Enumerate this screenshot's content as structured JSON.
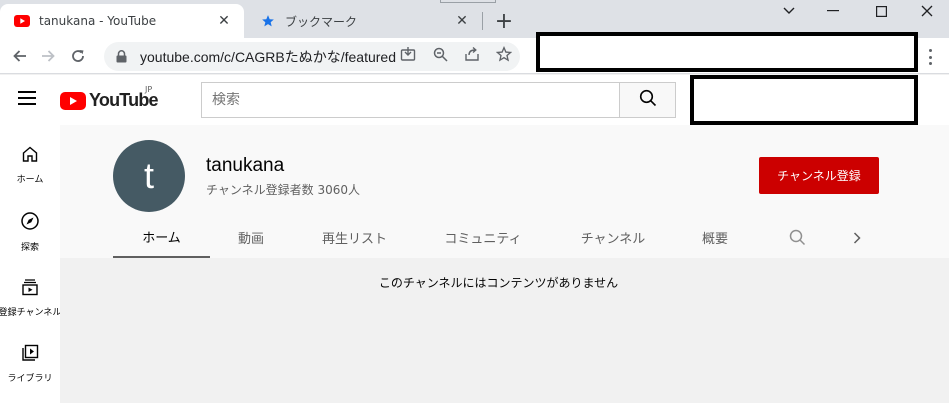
{
  "browser": {
    "tabs": [
      {
        "title": "tanukana - YouTube",
        "active": true,
        "favicon": "youtube-icon"
      },
      {
        "title": "ブックマーク",
        "active": false,
        "favicon": "star-icon"
      }
    ],
    "url": "youtube.com/c/CAGRBたぬかな/featured"
  },
  "youtube": {
    "search_placeholder": "検索",
    "logo_text": "YouTube",
    "region": "JP"
  },
  "guide": {
    "items": [
      {
        "label": "ホーム",
        "icon": "home-icon"
      },
      {
        "label": "探索",
        "icon": "compass-icon"
      },
      {
        "label": "登録チャンネル",
        "icon": "subscriptions-icon"
      },
      {
        "label": "ライブラリ",
        "icon": "library-icon"
      }
    ]
  },
  "channel": {
    "avatar_letter": "t",
    "name": "tanukana",
    "subscribers": "チャンネル登録者数 3060人",
    "subscribe_label": "チャンネル登録",
    "tabs": [
      "ホーム",
      "動画",
      "再生リスト",
      "コミュニティ",
      "チャンネル",
      "概要"
    ],
    "selected_tab": "ホーム"
  },
  "content": {
    "empty_message": "このチャンネルにはコンテンツがありません"
  },
  "colors": {
    "brand_red": "#ff0000",
    "subscribe_red": "#cc0000",
    "avatar_bg": "#455a64",
    "chrome_blue": "#1a73e8"
  }
}
